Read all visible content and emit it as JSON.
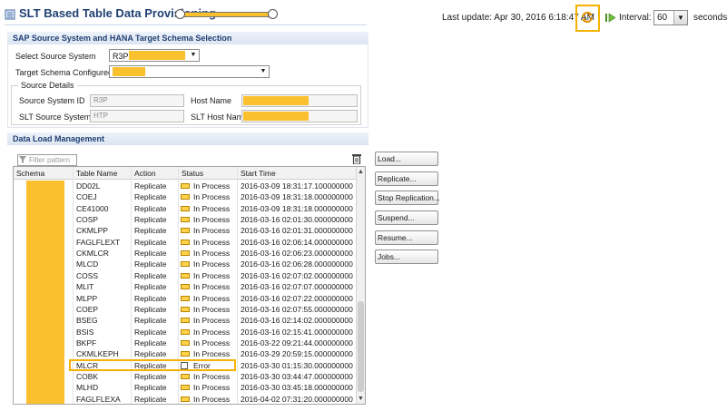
{
  "header": {
    "title": "SLT Based Table Data Provisioning",
    "last_update_label": "Last update:",
    "last_update_value": "Apr 30, 2016 6:18:47 AM",
    "interval_label": "Interval:",
    "interval_value": "60",
    "seconds_label": "seconds"
  },
  "source_section": {
    "title": "SAP Source System and HANA Target Schema Selection",
    "select_source_label": "Select Source System",
    "select_source_value": "R3P",
    "target_schema_label": "Target Schema Configured",
    "source_details_label": "Source Details",
    "source_system_id_label": "Source System ID",
    "source_system_id_value": "R3P",
    "host_name_label": "Host Name",
    "slt_system_id_label": "SLT Source System ID",
    "slt_system_id_value": "HTP",
    "slt_host_name_label": "SLT Host Name"
  },
  "data_load": {
    "title": "Data Load Management",
    "filter_placeholder": "Filter pattern",
    "columns": [
      "Schema",
      "Table Name",
      "Action",
      "Status",
      "Start Time"
    ],
    "rows": [
      {
        "table": "DD02L",
        "action": "Replicate",
        "status": "In Process",
        "start": "2016-03-09 18:31:17.100000000"
      },
      {
        "table": "COEJ",
        "action": "Replicate",
        "status": "In Process",
        "start": "2016-03-09 18:31:18.000000000"
      },
      {
        "table": "CE41000",
        "action": "Replicate",
        "status": "In Process",
        "start": "2016-03-09 18:31:18.000000000"
      },
      {
        "table": "COSP",
        "action": "Replicate",
        "status": "In Process",
        "start": "2016-03-16 02:01:30.000000000"
      },
      {
        "table": "CKMLPP",
        "action": "Replicate",
        "status": "In Process",
        "start": "2016-03-16 02:01:31.000000000"
      },
      {
        "table": "FAGLFLEXT",
        "action": "Replicate",
        "status": "In Process",
        "start": "2016-03-16 02:06:14.000000000"
      },
      {
        "table": "CKMLCR",
        "action": "Replicate",
        "status": "In Process",
        "start": "2016-03-16 02:06:23.000000000"
      },
      {
        "table": "MLCD",
        "action": "Replicate",
        "status": "In Process",
        "start": "2016-03-16 02:06:28.000000000"
      },
      {
        "table": "COSS",
        "action": "Replicate",
        "status": "In Process",
        "start": "2016-03-16 02:07:02.000000000"
      },
      {
        "table": "MLIT",
        "action": "Replicate",
        "status": "In Process",
        "start": "2016-03-16 02:07:07.000000000"
      },
      {
        "table": "MLPP",
        "action": "Replicate",
        "status": "In Process",
        "start": "2016-03-16 02:07:22.000000000"
      },
      {
        "table": "COEP",
        "action": "Replicate",
        "status": "In Process",
        "start": "2016-03-16 02:07:55.000000000"
      },
      {
        "table": "BSEG",
        "action": "Replicate",
        "status": "In Process",
        "start": "2016-03-16 02:14:02.000000000"
      },
      {
        "table": "BSIS",
        "action": "Replicate",
        "status": "In Process",
        "start": "2016-03-16 02:15:41.000000000"
      },
      {
        "table": "BKPF",
        "action": "Replicate",
        "status": "In Process",
        "start": "2016-03-22 09:21:44.000000000"
      },
      {
        "table": "CKMLKEPH",
        "action": "Replicate",
        "status": "In Process",
        "start": "2016-03-29 20:59:15.000000000"
      },
      {
        "table": "MLCR",
        "action": "Replicate",
        "status": "Error",
        "start": "2016-03-30 01:15:30.000000000"
      },
      {
        "table": "COBK",
        "action": "Replicate",
        "status": "In Process",
        "start": "2016-03-30 03:44:47.000000000"
      },
      {
        "table": "MLHD",
        "action": "Replicate",
        "status": "In Process",
        "start": "2016-03-30 03:45:18.000000000"
      },
      {
        "table": "FAGLFLEXA",
        "action": "Replicate",
        "status": "In Process",
        "start": "2016-04-02 07:31:20.000000000"
      }
    ],
    "buttons": {
      "load": "Load...",
      "replicate": "Replicate...",
      "stop": "Stop Replication...",
      "suspend": "Suspend...",
      "resume": "Resume...",
      "jobs": "Jobs..."
    }
  },
  "colors": {
    "highlight": "#f5b200",
    "redaction": "#fbc02d",
    "section_title": "#1f3f73"
  },
  "icons": [
    "provisioning-icon",
    "refresh-icon",
    "play-icon",
    "dropdown-arrow-icon",
    "filter-icon",
    "trash-icon",
    "in-process-icon",
    "error-icon"
  ]
}
